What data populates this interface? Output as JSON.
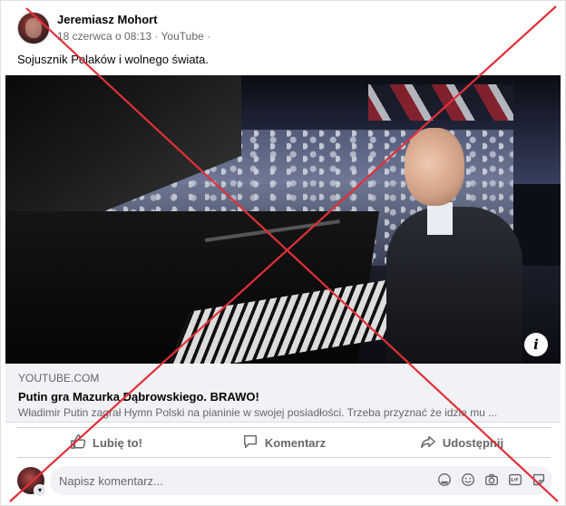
{
  "post": {
    "author": "Jeremiasz Mohort",
    "date": "18 czerwca o 08:13",
    "source": "YouTube",
    "separator": "·",
    "text": "Sojusznik Polaków i wolnego świata."
  },
  "link_preview": {
    "domain": "YOUTUBE.COM",
    "title": "Putin gra Mazurka Dąbrowskiego. BRAWO!",
    "description": "Władimir Putin zagrał Hymn Polski na pianinie w swojej posiadłości. Trzeba przyznać że idzie mu ..."
  },
  "actions": {
    "like": "Lubię to!",
    "comment": "Komentarz",
    "share": "Udostępnij"
  },
  "comment": {
    "placeholder": "Napisz komentarz..."
  },
  "media": {
    "info_icon": "i"
  },
  "colors": {
    "cross": "#e0303a",
    "secondary_text": "#65676b"
  }
}
